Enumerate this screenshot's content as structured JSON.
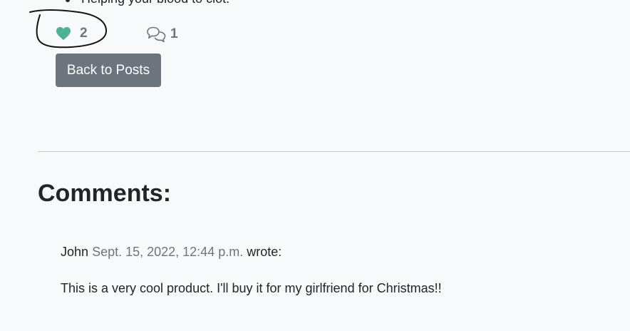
{
  "post": {
    "bullet_text": "Helping your blood to clot.",
    "likes_count": "2",
    "comments_count": "1",
    "back_label": "Back to Posts"
  },
  "comments": {
    "heading": "Comments:",
    "items": [
      {
        "author": "John",
        "date": "Sept. 15, 2022, 12:44 p.m.",
        "wrote": "wrote:",
        "body": "This is a very cool product. I'll buy it for my girlfriend for Christmas!!"
      }
    ]
  },
  "colors": {
    "background": "#f8f9fa",
    "heart": "#4db392",
    "secondary": "#6c757d",
    "text": "#212529"
  },
  "icons": {
    "like": "heart-icon",
    "comment": "comments-icon"
  }
}
